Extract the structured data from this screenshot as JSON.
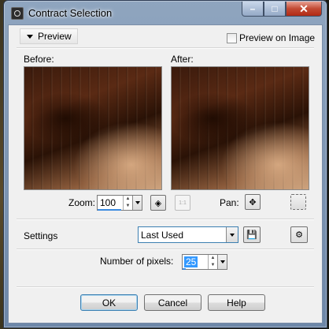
{
  "window": {
    "title": "Contract Selection",
    "caption": {
      "minimize": "–",
      "maximize": "□",
      "close": "✕"
    }
  },
  "preview": {
    "toggle_label": "Preview",
    "preview_on_image_label": "Preview on Image",
    "preview_on_image_checked": false,
    "before_label": "Before:",
    "after_label": "After:"
  },
  "zoom": {
    "label": "Zoom:",
    "value": "100",
    "fit_icon": "fit-icon",
    "actual_size_label": "1:1",
    "actual_size_enabled": false
  },
  "pan": {
    "label": "Pan:",
    "move_icon": "move-icon",
    "navigate_icon": "navigate-icon"
  },
  "settings": {
    "label": "Settings",
    "selected": "Last Used",
    "save_icon": "save-icon",
    "manage_icon": "manage-presets-icon"
  },
  "params": {
    "pixels_label": "Number of pixels:",
    "pixels_value": "25"
  },
  "buttons": {
    "ok": "OK",
    "cancel": "Cancel",
    "help": "Help"
  },
  "colors": {
    "accent": "#3c7fb1",
    "dialog_bg": "#f0f0f0",
    "close_red": "#c24a33"
  }
}
